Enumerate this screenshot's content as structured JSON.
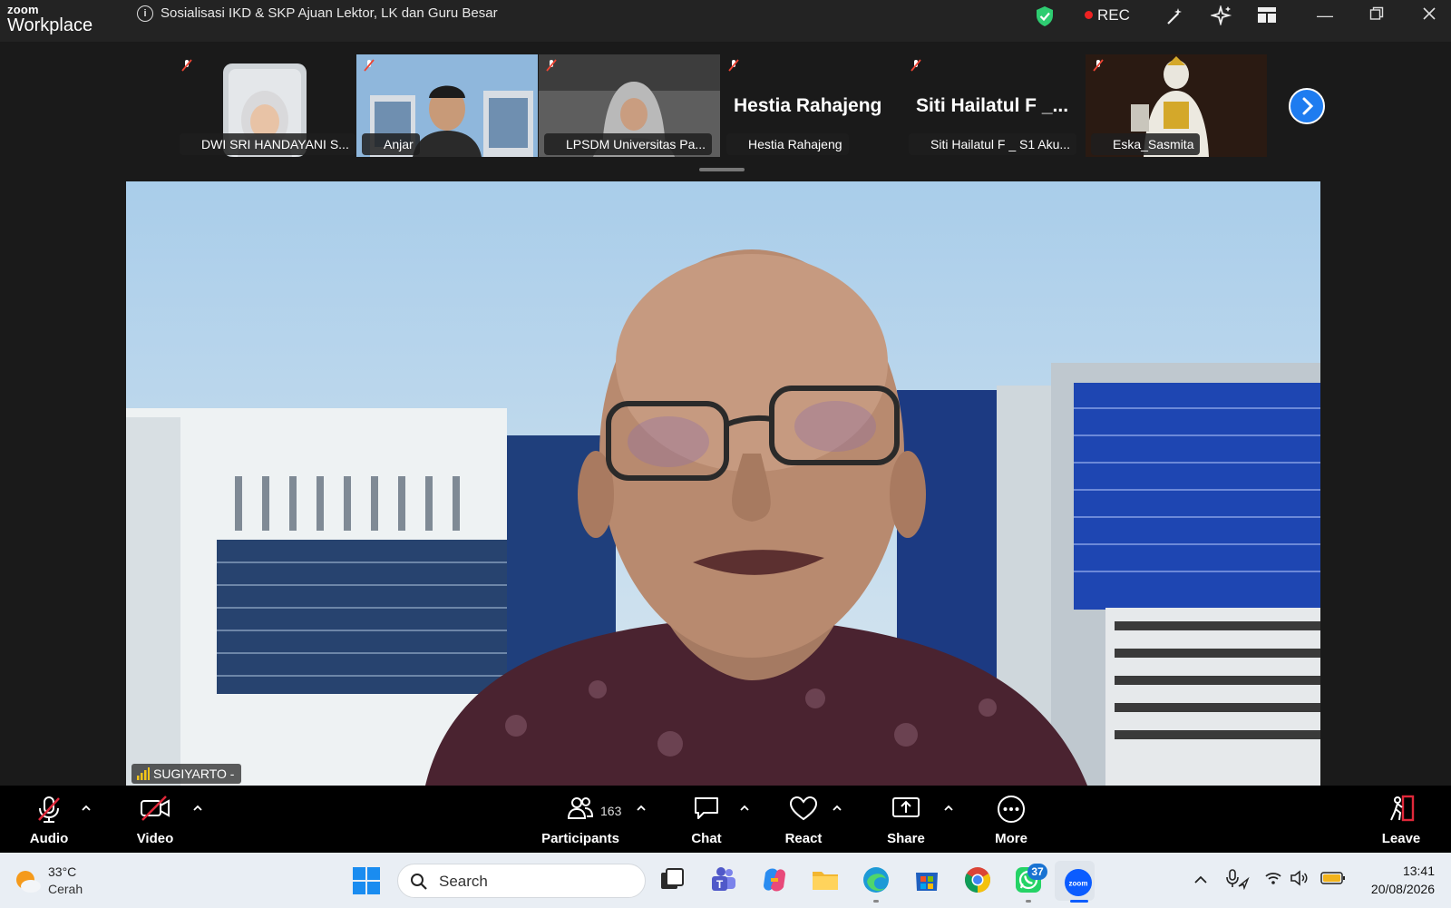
{
  "app": {
    "logo_top": "zoom",
    "logo_bottom": "Workplace"
  },
  "meeting": {
    "title": "Sosialisasi IKD & SKP Ajuan Lektor, LK dan Guru Besar",
    "rec_label": "REC"
  },
  "participants_strip": [
    {
      "name": "DWI SRI HANDAYANI S...",
      "display": "photo"
    },
    {
      "name": "Anjar",
      "display": "photo"
    },
    {
      "name": "LPSDM Universitas Pa...",
      "display": "photo"
    },
    {
      "name": "Hestia Rahajeng",
      "display": "text",
      "big_name": "Hestia Rahajeng"
    },
    {
      "name": "Siti Hailatul F _ S1 Aku...",
      "display": "text",
      "big_name": "Siti Hailatul F _..."
    },
    {
      "name": "Eska_Sasmita",
      "display": "photo"
    }
  ],
  "speaker": {
    "name": "SUGIYARTO -"
  },
  "controls": {
    "audio": "Audio",
    "video": "Video",
    "participants": "Participants",
    "participants_count": "163",
    "chat": "Chat",
    "react": "React",
    "share": "Share",
    "more": "More",
    "leave": "Leave"
  },
  "taskbar": {
    "weather_temp": "33°C",
    "weather_desc": "Cerah",
    "search_placeholder": "Search",
    "whatsapp_badge": "37",
    "time": "13:41",
    "date": "20/08/2026"
  },
  "colors": {
    "accent_blue": "#1e7cf0",
    "rec_red": "#e22222",
    "leave_red": "#e0283a",
    "shield_green": "#2ecc71"
  }
}
